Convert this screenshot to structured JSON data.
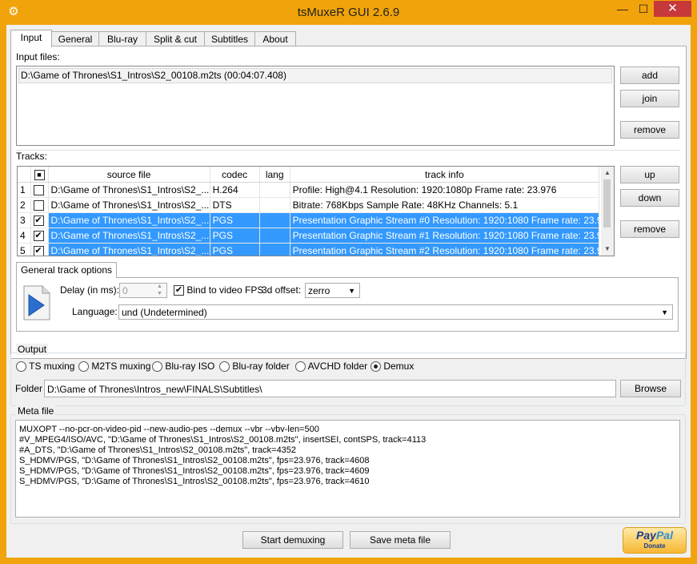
{
  "window": {
    "title": "tsMuxeR GUI 2.6.9",
    "min": "—",
    "max": "☐",
    "close": "✕"
  },
  "tabs": [
    "Input",
    "General",
    "Blu-ray",
    "Split & cut",
    "Subtitles",
    "About"
  ],
  "input": {
    "label": "Input files:",
    "files": [
      "D:\\Game of Thrones\\S1_Intros\\S2_00108.m2ts (00:04:07.408)"
    ],
    "buttons": {
      "add": "add",
      "join": "join",
      "remove": "remove"
    }
  },
  "tracks": {
    "label": "Tracks:",
    "headers": {
      "source": "source file",
      "codec": "codec",
      "lang": "lang",
      "info": "track info"
    },
    "rows": [
      {
        "n": "1",
        "checked": false,
        "selected": false,
        "source": "D:\\Game of Thrones\\S1_Intros\\S2_...",
        "codec": "H.264",
        "lang": "",
        "info": "Profile: High@4.1  Resolution: 1920:1080p  Frame rate: 23.976"
      },
      {
        "n": "2",
        "checked": false,
        "selected": false,
        "source": "D:\\Game of Thrones\\S1_Intros\\S2_...",
        "codec": "DTS",
        "lang": "",
        "info": "Bitrate: 768Kbps  Sample Rate: 48KHz  Channels: 5.1"
      },
      {
        "n": "3",
        "checked": true,
        "selected": true,
        "source": "D:\\Game of Thrones\\S1_Intros\\S2_...",
        "codec": "PGS",
        "lang": "",
        "info": "Presentation Graphic Stream #0 Resolution: 1920:1080 Frame rate: 23.9..."
      },
      {
        "n": "4",
        "checked": true,
        "selected": true,
        "source": "D:\\Game of Thrones\\S1_Intros\\S2_...",
        "codec": "PGS",
        "lang": "",
        "info": "Presentation Graphic Stream #1 Resolution: 1920:1080 Frame rate: 23.9..."
      },
      {
        "n": "5",
        "checked": true,
        "selected": true,
        "source": "D:\\Game of Thrones\\S1_Intros\\S2_...",
        "codec": "PGS",
        "lang": "",
        "info": "Presentation Graphic Stream #2 Resolution: 1920:1080 Frame rate: 23.9..."
      }
    ],
    "buttons": {
      "up": "up",
      "down": "down",
      "remove": "remove"
    }
  },
  "track_options": {
    "tab": "General track options",
    "delay_label": "Delay (in ms):",
    "delay_value": "0",
    "bind_fps_label": "Bind to video FPS",
    "bind_fps_checked": true,
    "offset_label": "3d offset:",
    "offset_value": "zerro",
    "language_label": "Language:",
    "language_value": "und (Undetermined)"
  },
  "output": {
    "label": "Output",
    "modes": [
      {
        "label": "TS muxing",
        "selected": false
      },
      {
        "label": "M2TS muxing",
        "selected": false
      },
      {
        "label": "Blu-ray ISO",
        "selected": false
      },
      {
        "label": "Blu-ray folder",
        "selected": false
      },
      {
        "label": "AVCHD folder",
        "selected": false
      },
      {
        "label": "Demux",
        "selected": true
      }
    ],
    "folder_label": "Folder",
    "folder_value": "D:\\Game of Thrones\\Intros_new\\FINALS\\Subtitles\\",
    "browse": "Browse"
  },
  "meta": {
    "label": "Meta file",
    "lines": [
      "MUXOPT --no-pcr-on-video-pid --new-audio-pes --demux --vbr  --vbv-len=500",
      "#V_MPEG4/ISO/AVC, \"D:\\Game of Thrones\\S1_Intros\\S2_00108.m2ts\", insertSEI, contSPS, track=4113",
      "#A_DTS, \"D:\\Game of Thrones\\S1_Intros\\S2_00108.m2ts\", track=4352",
      "S_HDMV/PGS, \"D:\\Game of Thrones\\S1_Intros\\S2_00108.m2ts\", fps=23.976, track=4608",
      "S_HDMV/PGS, \"D:\\Game of Thrones\\S1_Intros\\S2_00108.m2ts\", fps=23.976, track=4609",
      "S_HDMV/PGS, \"D:\\Game of Thrones\\S1_Intros\\S2_00108.m2ts\", fps=23.976, track=4610"
    ]
  },
  "actions": {
    "start": "Start demuxing",
    "save": "Save meta file"
  },
  "paypal": {
    "brand_pay": "Pay",
    "brand_pal": "Pal",
    "donate": "Donate"
  },
  "colors": {
    "accent": "#f0a30a",
    "selection": "#3399ff",
    "close": "#c7383a"
  }
}
